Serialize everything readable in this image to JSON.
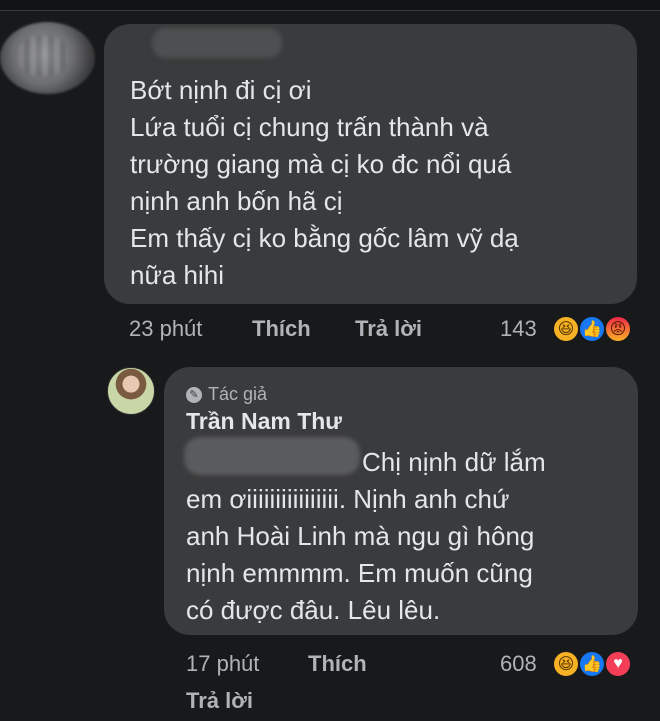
{
  "comment1": {
    "lines": [
      "Bớt nịnh đi cị ơi",
      "Lứa tuổi cị chung trấn thành và",
      "trường giang mà cị ko đc nổi quá",
      "nịnh anh bốn hã cị",
      "Em thấy cị ko bằng gốc lâm vỹ dạ",
      "nữa hihi"
    ],
    "time": "23 phút",
    "like_label": "Thích",
    "reply_label": "Trả lời",
    "reaction_count": "143",
    "reactions": [
      "haha-icon",
      "like-icon",
      "angry-icon"
    ]
  },
  "reply": {
    "author_tag": "Tác giả",
    "author_name": "Trần Nam Thư",
    "lines": [
      "Chị nịnh dữ lắm",
      "em ơiiiiiiiiiiiiiiii. Nịnh anh chứ",
      "anh Hoài Linh mà ngu gì hông",
      "nịnh emmmm. Em muốn cũng",
      "có được đâu. Lêu lêu."
    ],
    "time": "17 phút",
    "like_label": "Thích",
    "reply_label": "Trả lời",
    "reaction_count": "608",
    "reactions": [
      "haha-icon",
      "like-icon",
      "love-icon"
    ]
  },
  "colors": {
    "background": "#18191a",
    "bubble": "#3a3b3c",
    "text": "#e4e6eb",
    "secondary": "#b0b3b8"
  }
}
